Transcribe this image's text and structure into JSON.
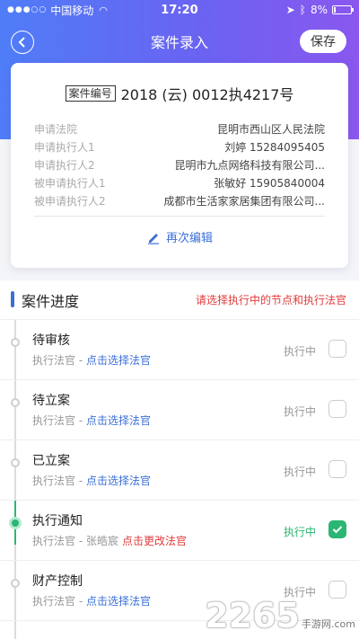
{
  "status": {
    "carrier": "中国移动",
    "time": "17:20",
    "battery": "8%"
  },
  "nav": {
    "title": "案件录入",
    "save_label": "保存"
  },
  "card": {
    "case_tag": "案件编号",
    "case_number": "2018 (云) 0012执4217号",
    "rows": [
      {
        "label": "申请法院",
        "value": "昆明市西山区人民法院"
      },
      {
        "label": "申请执行人1",
        "value": "刘婷  15284095405"
      },
      {
        "label": "申请执行人2",
        "value": "昆明市九点网络科技有限公司..."
      },
      {
        "label": "被申请执行人1",
        "value": "张敏好  15905840004"
      },
      {
        "label": "被申请执行人2",
        "value": "成都市生活家家居集团有限公司..."
      }
    ],
    "edit_label": "再次编辑"
  },
  "progress": {
    "title": "案件进度",
    "hint": "请选择执行中的节点和执行法官",
    "steps": [
      {
        "name": "待审核",
        "judge_label": "执行法官 - ",
        "action": "点击选择法官",
        "state": "执行中",
        "checked": false
      },
      {
        "name": "待立案",
        "judge_label": "执行法官 - ",
        "action": "点击选择法官",
        "state": "执行中",
        "checked": false
      },
      {
        "name": "已立案",
        "judge_label": "执行法官 - ",
        "action": "点击选择法官",
        "state": "执行中",
        "checked": false
      },
      {
        "name": "执行通知",
        "judge_label": "执行法官 - ",
        "judge_name": "张皓宸",
        "action": "点击更改法官",
        "state": "执行中",
        "checked": true
      },
      {
        "name": "财产控制",
        "judge_label": "执行法官 - ",
        "action": "点击选择法官",
        "state": "执行中",
        "checked": false
      }
    ]
  },
  "watermark": {
    "brand": "2265",
    "sub": "手游网",
    "url": ".com"
  }
}
